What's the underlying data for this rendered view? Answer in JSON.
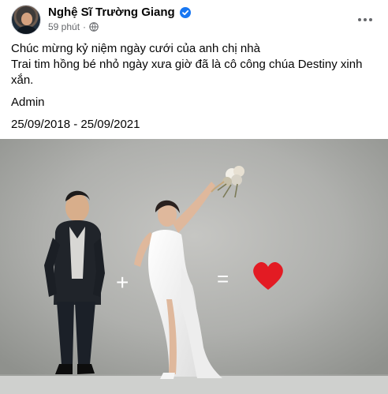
{
  "author": {
    "name": "Nghệ Sĩ Trường Giang",
    "verified_icon": "verified-check-icon"
  },
  "meta": {
    "time": "59 phút",
    "separator": "·",
    "audience_icon": "globe-icon"
  },
  "more_icon": "more-horizontal-icon",
  "post_text": {
    "line1": "Chúc mừng kỷ niệm ngày cưới của anh chị nhà",
    "line2": "Trai tim hồng bé nhỏ ngày xưa giờ đã là cô công chúa Destiny xinh xắn.",
    "signature": "Admin",
    "dates": "25/09/2018 - 25/09/2021"
  },
  "photo": {
    "description_icon": "wedding-photo",
    "plus_symbol": "+",
    "equals_symbol": "=",
    "heart_color": "#e31b23"
  },
  "colors": {
    "verified": "#1877f2",
    "secondary_text": "#65676b"
  }
}
